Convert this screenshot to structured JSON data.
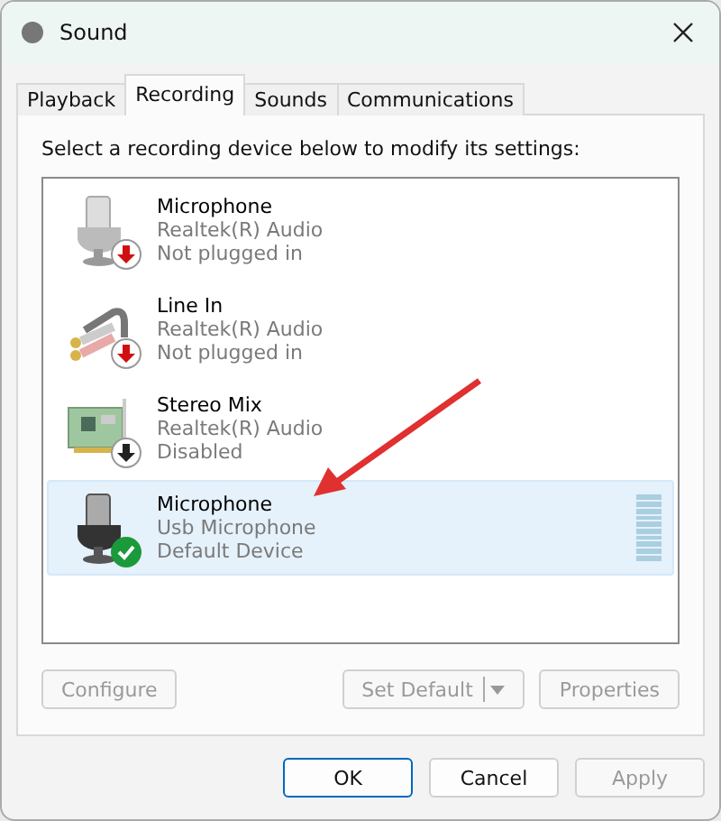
{
  "window": {
    "title": "Sound"
  },
  "tabs": [
    {
      "label": "Playback",
      "selected": false
    },
    {
      "label": "Recording",
      "selected": true
    },
    {
      "label": "Sounds",
      "selected": false
    },
    {
      "label": "Communications",
      "selected": false
    }
  ],
  "instruction": "Select a recording device below to modify its settings:",
  "devices": [
    {
      "name": "Microphone",
      "driver": "Realtek(R) Audio",
      "status": "Not plugged in",
      "kind": "microphone",
      "plugged_in": false,
      "disabled": false,
      "default": false,
      "selected": false
    },
    {
      "name": "Line In",
      "driver": "Realtek(R) Audio",
      "status": "Not plugged in",
      "kind": "cable",
      "plugged_in": false,
      "disabled": false,
      "default": false,
      "selected": false
    },
    {
      "name": "Stereo Mix",
      "driver": "Realtek(R) Audio",
      "status": "Disabled",
      "kind": "card",
      "plugged_in": true,
      "disabled": true,
      "default": false,
      "selected": false
    },
    {
      "name": "Microphone",
      "driver": "Usb Microphone",
      "status": "Default Device",
      "kind": "usb-microphone",
      "plugged_in": true,
      "disabled": false,
      "default": true,
      "selected": true
    }
  ],
  "panel_buttons": [
    {
      "label": "Configure",
      "disabled": true,
      "kind": "plain"
    },
    {
      "label": "Set Default",
      "disabled": true,
      "kind": "split"
    },
    {
      "label": "Properties",
      "disabled": true,
      "kind": "plain"
    }
  ],
  "dialog_buttons": [
    {
      "label": "OK",
      "disabled": false,
      "default": true
    },
    {
      "label": "Cancel",
      "disabled": false,
      "default": false
    },
    {
      "label": "Apply",
      "disabled": true,
      "default": false
    }
  ]
}
